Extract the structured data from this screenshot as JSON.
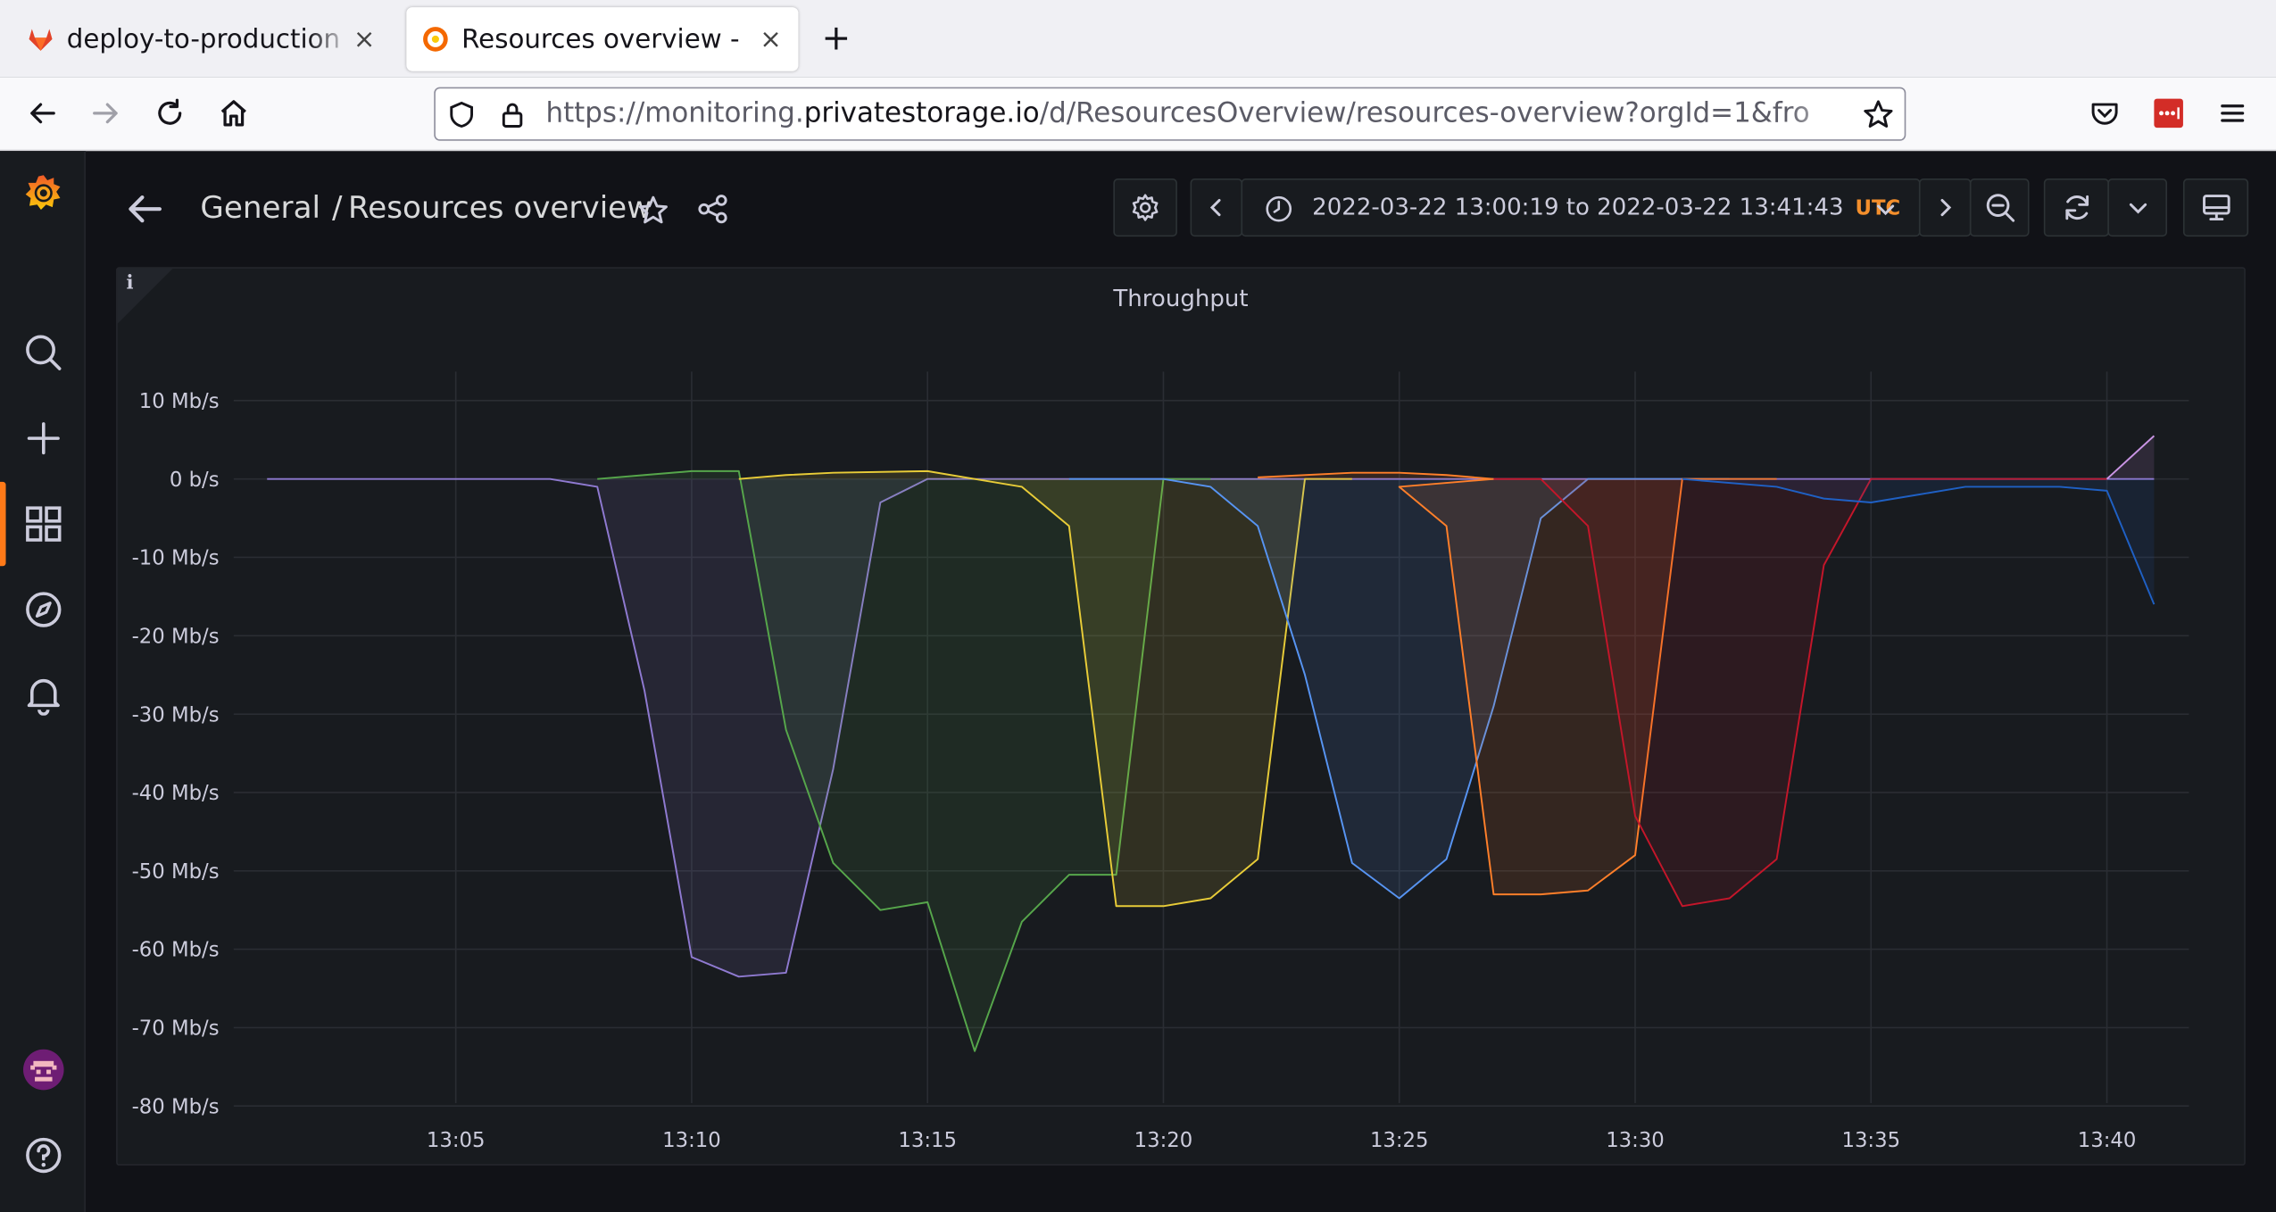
{
  "browser": {
    "tabs": [
      {
        "label": "deploy-to-production (",
        "active": false
      },
      {
        "label": "Resources overview - ",
        "active": true
      }
    ],
    "url_prefix": "https://monitoring.",
    "url_domain": "privatestorage.io",
    "url_path": "/d/ResourcesOverview/resources-overview?orgId=1&fro"
  },
  "icons": {
    "sidebar": [
      "grafana-logo-icon",
      "search-icon",
      "plus-icon",
      "dashboards-icon",
      "explore-icon",
      "bell-icon",
      "avatar",
      "help-icon"
    ],
    "toolbar": [
      "back-arrow-icon",
      "star-icon",
      "share-icon",
      "gear-icon",
      "chevron-left-icon",
      "clock-icon",
      "chevron-down-icon",
      "chevron-right-icon",
      "zoom-out-icon",
      "refresh-icon",
      "tv-icon"
    ]
  },
  "header": {
    "breadcrumb_folder": "General",
    "breadcrumb_sep": "/",
    "dashboard_title": "Resources overview",
    "time_range": "2022-03-22 13:00:19 to 2022-03-22 13:41:43",
    "timezone": "UTC"
  },
  "panel": {
    "title": "Throughput",
    "info_glyph": "i"
  },
  "chart_data": {
    "type": "line",
    "title": "Throughput",
    "x_unit": "time (13:00:19 – 13:41:43)",
    "xticks": [
      "13:05",
      "13:10",
      "13:15",
      "13:20",
      "13:25",
      "13:30",
      "13:35",
      "13:40"
    ],
    "yticks": [
      "10 Mb/s",
      "0 b/s",
      "-10 Mb/s",
      "-20 Mb/s",
      "-30 Mb/s",
      "-40 Mb/s",
      "-50 Mb/s",
      "-60 Mb/s",
      "-70 Mb/s",
      "-80 Mb/s"
    ],
    "ylim": [
      -80,
      10
    ],
    "grid": true,
    "fill": true,
    "series": [
      {
        "color": "#8f7ad1",
        "points": [
          [
            "13:01",
            0
          ],
          [
            "13:07",
            0
          ],
          [
            "13:08",
            -1
          ],
          [
            "13:09",
            -27
          ],
          [
            "13:10",
            -61
          ],
          [
            "13:11",
            -63.5
          ],
          [
            "13:12",
            -63
          ],
          [
            "13:13",
            -37
          ],
          [
            "13:14",
            -3
          ],
          [
            "13:15",
            0
          ],
          [
            "13:41",
            0
          ]
        ]
      },
      {
        "color": "#56a64b",
        "points": [
          [
            "13:08",
            0
          ],
          [
            "13:09",
            0.5
          ],
          [
            "13:10",
            1
          ],
          [
            "13:11",
            1
          ],
          [
            "13:12",
            -32
          ],
          [
            "13:13",
            -49
          ],
          [
            "13:14",
            -55
          ],
          [
            "13:15",
            -54
          ],
          [
            "13:16",
            -73
          ],
          [
            "13:17",
            -56.5
          ],
          [
            "13:18",
            -50.5
          ],
          [
            "13:19",
            -50.5
          ],
          [
            "13:20",
            0
          ],
          [
            "13:21",
            0
          ]
        ]
      },
      {
        "color": "#e8cc38",
        "points": [
          [
            "13:11",
            0
          ],
          [
            "13:12",
            0.5
          ],
          [
            "13:13",
            0.8
          ],
          [
            "13:15",
            1
          ],
          [
            "13:16",
            0
          ],
          [
            "13:17",
            -1
          ],
          [
            "13:18",
            -6
          ],
          [
            "13:19",
            -54.5
          ],
          [
            "13:20",
            -54.5
          ],
          [
            "13:21",
            -53.5
          ],
          [
            "13:22",
            -48.5
          ],
          [
            "13:23",
            0
          ],
          [
            "13:24",
            0
          ]
        ]
      },
      {
        "color": "#5794f2",
        "points": [
          [
            "13:18",
            0
          ],
          [
            "13:20",
            0
          ],
          [
            "13:21",
            -1
          ],
          [
            "13:22",
            -6
          ],
          [
            "13:23",
            -25
          ],
          [
            "13:24",
            -49
          ],
          [
            "13:25",
            -53.5
          ],
          [
            "13:26",
            -48.5
          ],
          [
            "13:27",
            -29
          ],
          [
            "13:28",
            -5
          ],
          [
            "13:29",
            0
          ],
          [
            "13:32",
            0
          ]
        ]
      },
      {
        "color": "#ff7f2a",
        "points": [
          [
            "13:22",
            0.2
          ],
          [
            "13:24",
            0.8
          ],
          [
            "13:25",
            0.8
          ],
          [
            "13:26",
            0.5
          ],
          [
            "13:27",
            0
          ],
          [
            "13:25",
            -1
          ],
          [
            "13:26",
            -6
          ],
          [
            "13:27",
            -53
          ],
          [
            "13:28",
            -53
          ],
          [
            "13:29",
            -52.5
          ],
          [
            "13:30",
            -48
          ],
          [
            "13:31",
            0
          ],
          [
            "13:33",
            0
          ]
        ]
      },
      {
        "color": "#c4162a",
        "points": [
          [
            "13:27",
            0
          ],
          [
            "13:28",
            0
          ],
          [
            "13:29",
            -6
          ],
          [
            "13:30",
            -43
          ],
          [
            "13:31",
            -54.5
          ],
          [
            "13:32",
            -53.5
          ],
          [
            "13:33",
            -48.5
          ],
          [
            "13:34",
            -11
          ],
          [
            "13:35",
            0
          ],
          [
            "13:40",
            0
          ]
        ]
      },
      {
        "color": "#1f60c4",
        "points": [
          [
            "13:31",
            0
          ],
          [
            "13:33",
            -1
          ],
          [
            "13:34",
            -2.5
          ],
          [
            "13:35",
            -3
          ],
          [
            "13:36",
            -2
          ],
          [
            "13:37",
            -1
          ],
          [
            "13:39",
            -1
          ],
          [
            "13:40",
            -1.5
          ],
          [
            "13:41",
            -16
          ]
        ]
      },
      {
        "color": "#ca95e5",
        "points": [
          [
            "13:40",
            0
          ],
          [
            "13:41",
            5.5
          ]
        ]
      }
    ]
  }
}
